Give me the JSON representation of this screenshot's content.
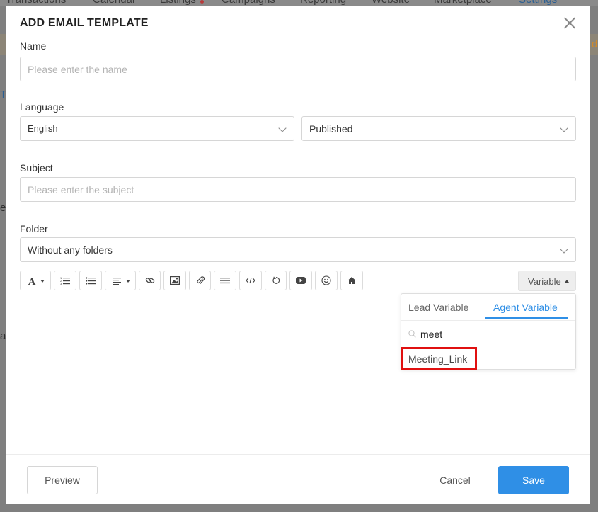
{
  "background": {
    "nav_items": [
      "Transactions",
      "Calendar",
      "Listings",
      "Campaigns",
      "Reporting",
      "Website",
      "Marketplace",
      "Settings"
    ],
    "fragments": [
      "T",
      "e",
      "a",
      "d"
    ]
  },
  "modal": {
    "title": "ADD EMAIL TEMPLATE",
    "close_icon": "close-icon"
  },
  "form": {
    "name": {
      "label": "Name",
      "placeholder": "Please enter the name",
      "value": ""
    },
    "language": {
      "label": "Language",
      "value": "English"
    },
    "status": {
      "value": "Published"
    },
    "subject": {
      "label": "Subject",
      "placeholder": "Please enter the subject",
      "value": ""
    },
    "folder": {
      "label": "Folder",
      "value": "Without any folders"
    }
  },
  "toolbar": {
    "tools": [
      "font-color-icon",
      "ordered-list-icon",
      "unordered-list-icon",
      "align-icon",
      "link-icon",
      "image-icon",
      "attachment-icon",
      "horizontal-rule-icon",
      "code-icon",
      "undo-icon",
      "video-icon",
      "emoji-icon",
      "home-icon"
    ],
    "variable_label": "Variable"
  },
  "variable_dropdown": {
    "tabs": [
      "Lead Variable",
      "Agent Variable"
    ],
    "active_tab": "Agent Variable",
    "search_value": "meet",
    "results": [
      "Meeting_Link"
    ],
    "accent_color": "#2f8fe6",
    "highlight_color": "#e01010"
  },
  "footer": {
    "preview_label": "Preview",
    "cancel_label": "Cancel",
    "save_label": "Save",
    "primary_color": "#2f8fe6"
  }
}
